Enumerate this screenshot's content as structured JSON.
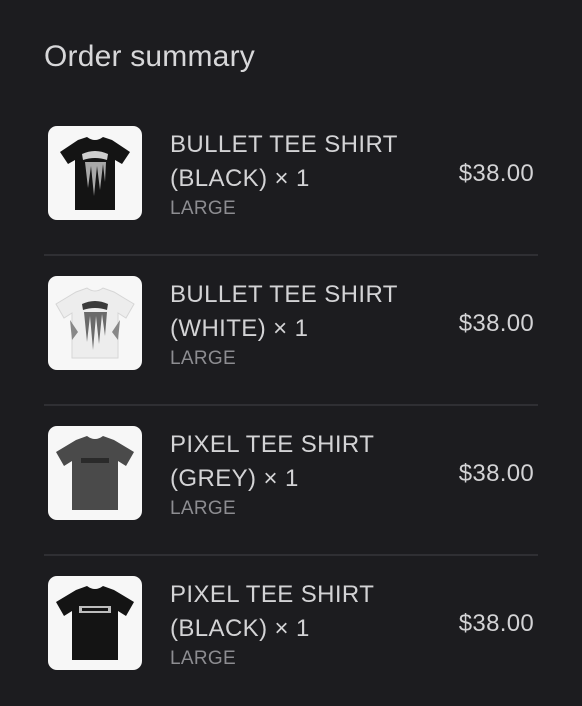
{
  "summary": {
    "title": "Order summary"
  },
  "items": [
    {
      "name_line1": "BULLET TEE SHIRT",
      "name_line2": "(BLACK) × 1",
      "variant": "LARGE",
      "price": "$38.00",
      "image_icon": "black-tshirt-icon",
      "shirt_color": "#141414"
    },
    {
      "name_line1": "BULLET TEE SHIRT",
      "name_line2": "(WHITE) × 1",
      "variant": "LARGE",
      "price": "$38.00",
      "image_icon": "white-tshirt-icon",
      "shirt_color": "#ededed"
    },
    {
      "name_line1": "PIXEL TEE SHIRT",
      "name_line2": "(GREY) × 1",
      "variant": "LARGE",
      "price": "$38.00",
      "image_icon": "grey-tshirt-icon",
      "shirt_color": "#4a4a4a"
    },
    {
      "name_line1": "PIXEL TEE SHIRT",
      "name_line2": "(BLACK) × 1",
      "variant": "LARGE",
      "price": "$38.00",
      "image_icon": "black-tshirt-icon",
      "shirt_color": "#141414"
    }
  ]
}
